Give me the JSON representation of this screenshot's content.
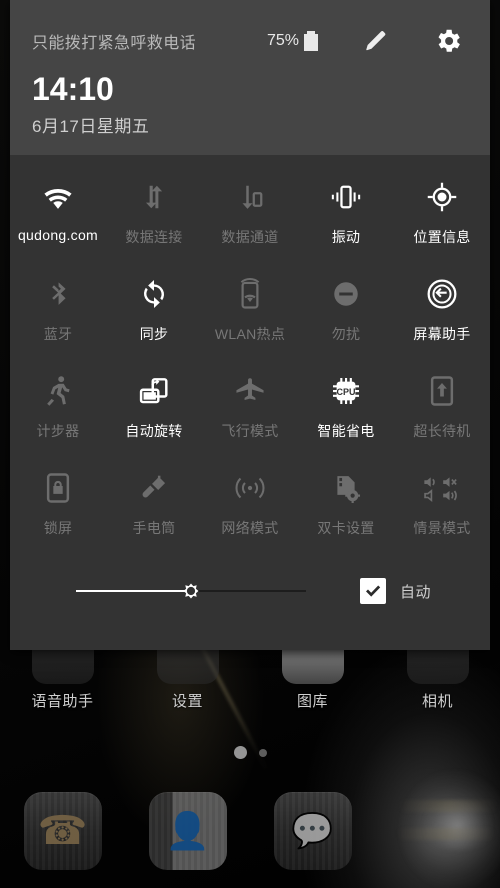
{
  "statusbar": {
    "carrier": "只能拨打紧急呼救电话",
    "battery_percent": "75%",
    "battery_icon": "battery-full-icon",
    "edit_icon": "pencil-edit-icon",
    "settings_icon": "gear-icon"
  },
  "header": {
    "time": "14:10",
    "date": "6月17日星期五"
  },
  "tiles": [
    [
      {
        "label": "qudong.com",
        "icon": "wifi-icon",
        "state": "on"
      },
      {
        "label": "数据连接",
        "icon": "data-connection-icon",
        "state": "off"
      },
      {
        "label": "数据通道",
        "icon": "data-channel-icon",
        "state": "off"
      },
      {
        "label": "振动",
        "icon": "vibrate-icon",
        "state": "on"
      },
      {
        "label": "位置信息",
        "icon": "location-icon",
        "state": "on"
      }
    ],
    [
      {
        "label": "蓝牙",
        "icon": "bluetooth-icon",
        "state": "off"
      },
      {
        "label": "同步",
        "icon": "sync-icon",
        "state": "on"
      },
      {
        "label": "WLAN热点",
        "icon": "wlan-hotspot-icon",
        "state": "off"
      },
      {
        "label": "勿扰",
        "icon": "do-not-disturb-icon",
        "state": "off"
      },
      {
        "label": "屏幕助手",
        "icon": "screen-assistant-icon",
        "state": "on"
      }
    ],
    [
      {
        "label": "计步器",
        "icon": "pedometer-icon",
        "state": "off"
      },
      {
        "label": "自动旋转",
        "icon": "auto-rotate-icon",
        "state": "on"
      },
      {
        "label": "飞行模式",
        "icon": "airplane-mode-icon",
        "state": "off"
      },
      {
        "label": "智能省电",
        "icon": "cpu-power-save-icon",
        "state": "on"
      },
      {
        "label": "超长待机",
        "icon": "ultra-standby-icon",
        "state": "off"
      }
    ],
    [
      {
        "label": "锁屏",
        "icon": "lock-screen-icon",
        "state": "off"
      },
      {
        "label": "手电筒",
        "icon": "flashlight-icon",
        "state": "off"
      },
      {
        "label": "网络模式",
        "icon": "network-mode-icon",
        "state": "off"
      },
      {
        "label": "双卡设置",
        "icon": "dual-sim-settings-icon",
        "state": "off"
      },
      {
        "label": "情景模式",
        "icon": "scene-mode-icon",
        "state": "off"
      }
    ]
  ],
  "brightness": {
    "value": 50,
    "thumb_icon": "brightness-sun-icon",
    "auto_label": "自动",
    "auto_checked": true,
    "check_icon": "checkmark-icon"
  },
  "home": {
    "apps": [
      {
        "label": "语音助手",
        "icon": "voice-assistant-icon"
      },
      {
        "label": "设置",
        "icon": "settings-app-icon"
      },
      {
        "label": "图库",
        "icon": "gallery-app-icon"
      },
      {
        "label": "相机",
        "icon": "camera-app-icon"
      }
    ],
    "page_dots": {
      "count": 2,
      "active_index": 0
    },
    "dock": [
      {
        "icon": "phone-dialer-icon"
      },
      {
        "icon": "contacts-icon"
      },
      {
        "icon": "messaging-icon"
      },
      {
        "icon": "browser-icon"
      }
    ]
  }
}
